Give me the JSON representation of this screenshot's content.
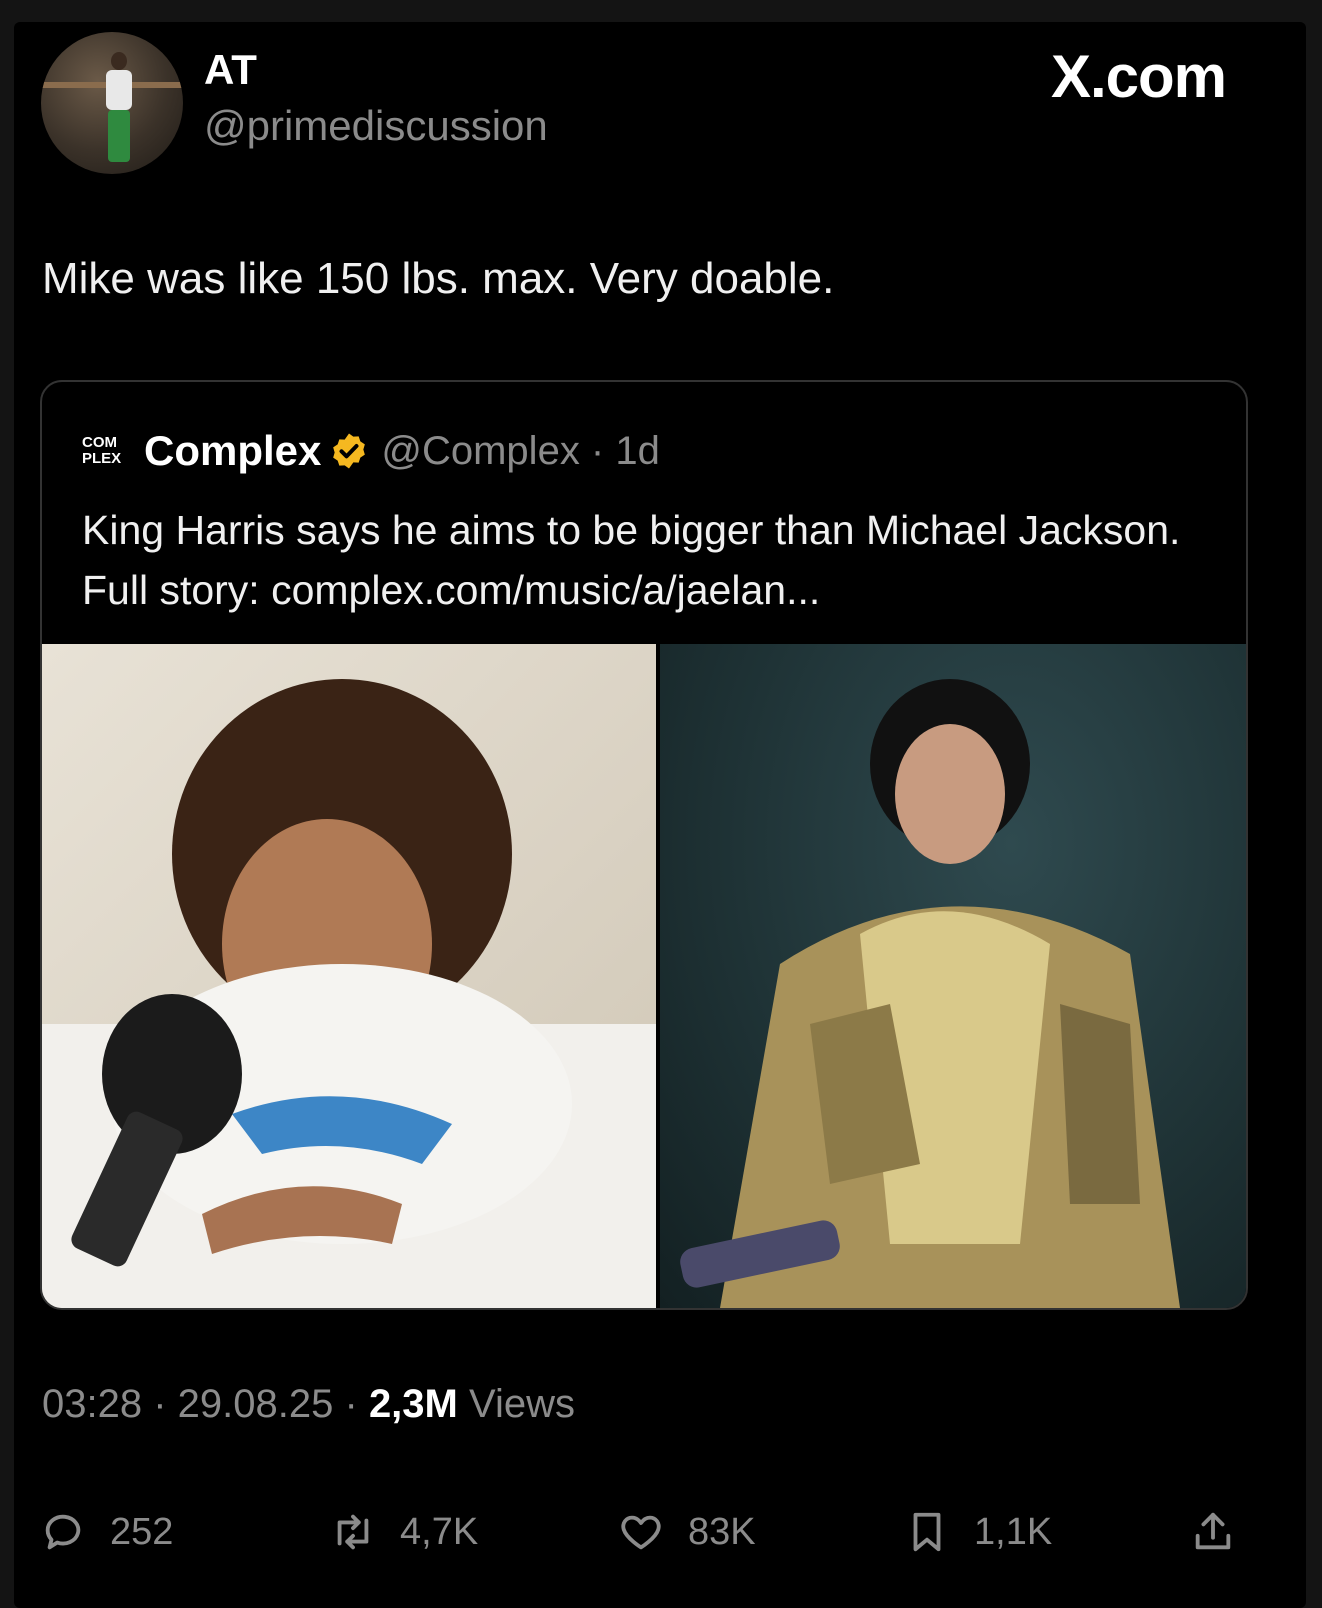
{
  "author": {
    "name": "AT",
    "handle": "@primediscussion"
  },
  "brand": {
    "logo_text": "X.com"
  },
  "tweet": {
    "text": "Mike was like 150 lbs. max. Very doable."
  },
  "quoted": {
    "logo_lines": [
      "COM",
      "PLEX"
    ],
    "name": "Complex",
    "handle_time": "@Complex · 1d",
    "text": "King Harris says he aims to be bigger than Michael Jackson. Full story: complex.com/music/a/jaelan...",
    "badge_color": "#f5b820"
  },
  "meta": {
    "time": "03:28",
    "date": "29.08.25",
    "views_count": "2,3M",
    "views_label": "Views"
  },
  "actions": {
    "replies": "252",
    "reposts": "4,7K",
    "likes": "83K",
    "bookmarks": "1,1K"
  }
}
